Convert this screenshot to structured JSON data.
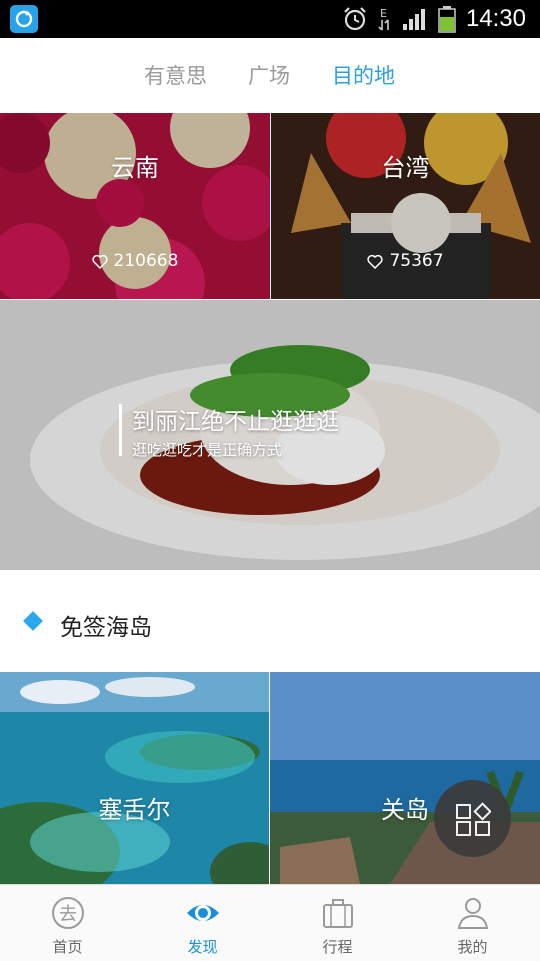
{
  "status_bar": {
    "time": "14:30"
  },
  "top_tabs": [
    {
      "label": "有意思"
    },
    {
      "label": "广场"
    },
    {
      "label": "目的地"
    }
  ],
  "tiles": {
    "yunnan": {
      "title": "云南",
      "likes": "210668"
    },
    "taiwan": {
      "title": "台湾",
      "likes": "75367"
    },
    "lijiang": {
      "title": "到丽江绝不止逛逛逛",
      "subtitle": "逛吃逛吃才是正确方式"
    },
    "seychelles": {
      "title": "塞舌尔"
    },
    "guam": {
      "title": "关岛"
    }
  },
  "section": {
    "title": "免签海岛"
  },
  "bottom_nav": [
    {
      "label": "首页",
      "icon": "qu-icon"
    },
    {
      "label": "发现",
      "icon": "eye-icon"
    },
    {
      "label": "行程",
      "icon": "luggage-icon"
    },
    {
      "label": "我的",
      "icon": "person-icon"
    }
  ],
  "colors": {
    "accent": "#2aa0e0",
    "section_marker": "#2aa8ee"
  }
}
